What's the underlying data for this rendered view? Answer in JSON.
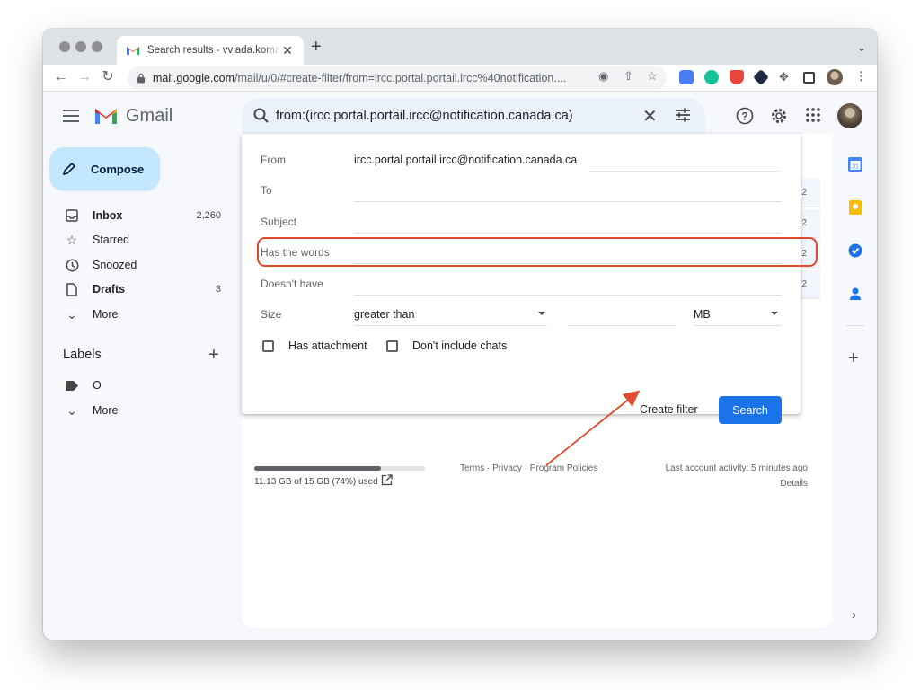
{
  "browser": {
    "tab_title": "Search results - vvlada.komar@",
    "url_host": "mail.google.com",
    "url_path": "/mail/u/0/#create-filter/from=ircc.portal.portail.ircc%40notification...."
  },
  "header": {
    "brand": "Gmail",
    "search_query": "from:(ircc.portal.portail.ircc@notification.canada.ca)"
  },
  "sidebar": {
    "compose_label": "Compose",
    "items": [
      {
        "label": "Inbox",
        "count": "2,260",
        "icon": "inbox-icon"
      },
      {
        "label": "Starred",
        "count": "",
        "icon": "star-icon"
      },
      {
        "label": "Snoozed",
        "count": "",
        "icon": "clock-icon"
      },
      {
        "label": "Drafts",
        "count": "3",
        "icon": "draft-icon"
      },
      {
        "label": "More",
        "count": "",
        "icon": "chevron-down-icon"
      }
    ],
    "labels_title": "Labels",
    "labels": [
      {
        "label": "O",
        "icon": "label-icon"
      },
      {
        "label": "More",
        "icon": "chevron-down-icon"
      }
    ]
  },
  "filter": {
    "from_label": "From",
    "from_value": "ircc.portal.portail.ircc@notification.canada.ca",
    "to_label": "To",
    "subject_label": "Subject",
    "has_words_label": "Has the words",
    "doesnt_have_label": "Doesn't have",
    "size_label": "Size",
    "size_operator": "greater than",
    "size_unit": "MB",
    "has_attachment_label": "Has attachment",
    "no_chats_label": "Don't include chats",
    "create_filter_label": "Create filter",
    "search_button_label": "Search"
  },
  "background_rows": [
    "22",
    "22",
    "22",
    "22"
  ],
  "footer": {
    "storage_text": "11.13 GB of 15 GB (74%) used",
    "storage_fraction": 0.74,
    "links": "Terms · Privacy · Program Policies",
    "activity": "Last account activity: 5 minutes ago",
    "details": "Details"
  },
  "colors": {
    "compose_bg": "#c2e7ff",
    "search_bg": "#eaf1fb",
    "primary_button": "#1a73e8",
    "annotation_red": "#e04a2f"
  }
}
